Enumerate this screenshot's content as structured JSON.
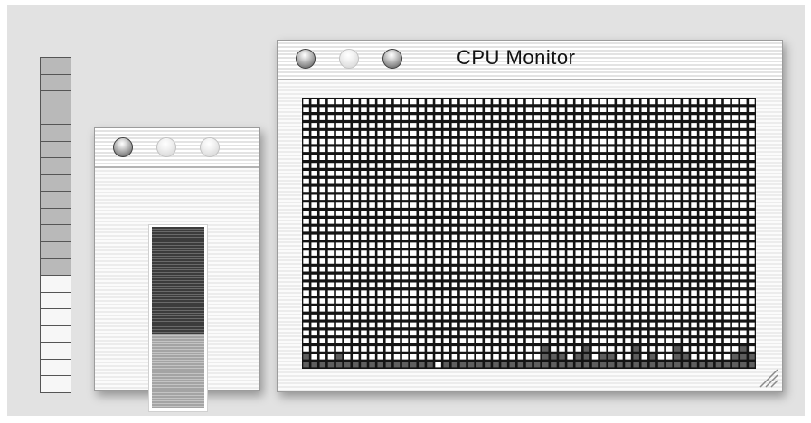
{
  "meter": {
    "total_cells": 20,
    "lit_cells": 13
  },
  "cpu_bar_window": {
    "buttons": [
      "close",
      "minimize",
      "zoom"
    ],
    "usage_fraction": 0.59,
    "colors": {
      "used": "#3c3c3c",
      "idle": "#a4a4a4"
    }
  },
  "cpu_monitor_window": {
    "title": "CPU Monitor",
    "buttons": [
      "close",
      "minimize",
      "zoom"
    ],
    "history": {
      "columns": 55,
      "rows": 34,
      "levels": [
        2,
        1,
        1,
        1,
        2,
        1,
        1,
        1,
        1,
        1,
        1,
        1,
        1,
        1,
        1,
        1,
        0,
        1,
        1,
        1,
        1,
        1,
        1,
        1,
        1,
        1,
        1,
        1,
        1,
        3,
        2,
        2,
        1,
        2,
        3,
        1,
        2,
        2,
        1,
        1,
        3,
        1,
        2,
        1,
        1,
        3,
        2,
        1,
        1,
        1,
        1,
        1,
        2,
        3,
        2
      ]
    },
    "colors": {
      "background": "#ffffff",
      "grid": "#141414",
      "activity": "#5e5e5e"
    }
  }
}
